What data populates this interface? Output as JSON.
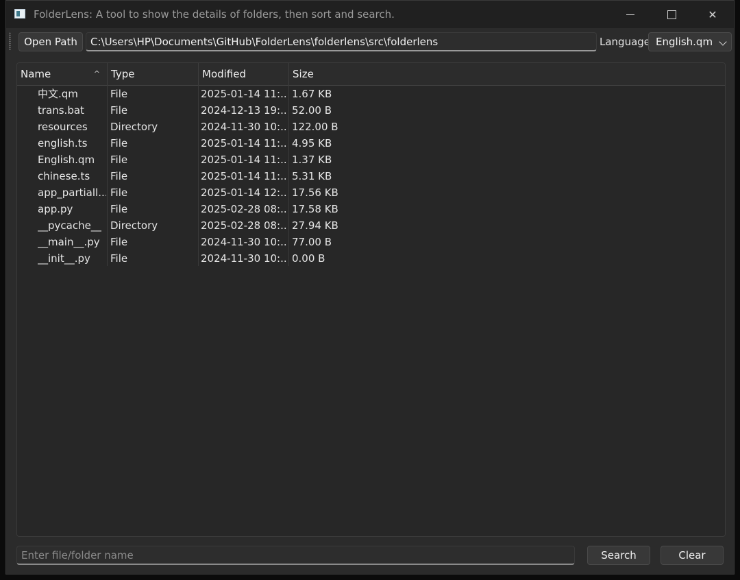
{
  "window": {
    "title": "FolderLens: A tool to show the details of folders, then sort and search."
  },
  "toolbar": {
    "open_path_label": "Open Path",
    "path_value": "C:\\Users\\HP\\Documents\\GitHub\\FolderLens\\folderlens\\src\\folderlens",
    "language_label": "Language",
    "language_selected": "English.qm"
  },
  "table": {
    "columns": [
      "Name",
      "Type",
      "Modified",
      "Size"
    ],
    "sort_indicator": "^",
    "rows": [
      {
        "name": "中文.qm",
        "type": "File",
        "modified": "2025-01-14 11:...",
        "size": "1.67 KB"
      },
      {
        "name": "trans.bat",
        "type": "File",
        "modified": "2024-12-13 19:...",
        "size": "52.00 B"
      },
      {
        "name": "resources",
        "type": "Directory",
        "modified": "2024-11-30 10:...",
        "size": "122.00 B"
      },
      {
        "name": "english.ts",
        "type": "File",
        "modified": "2025-01-14 11:...",
        "size": "4.95 KB"
      },
      {
        "name": "English.qm",
        "type": "File",
        "modified": "2025-01-14 11:...",
        "size": "1.37 KB"
      },
      {
        "name": "chinese.ts",
        "type": "File",
        "modified": "2025-01-14 11:...",
        "size": "5.31 KB"
      },
      {
        "name": "app_partiall...",
        "type": "File",
        "modified": "2025-01-14 12:...",
        "size": "17.56 KB"
      },
      {
        "name": "app.py",
        "type": "File",
        "modified": "2025-02-28 08:...",
        "size": "17.58 KB"
      },
      {
        "name": "__pycache__",
        "type": "Directory",
        "modified": "2025-02-28 08:...",
        "size": "27.94 KB"
      },
      {
        "name": "__main__.py",
        "type": "File",
        "modified": "2024-11-30 10:...",
        "size": "77.00 B"
      },
      {
        "name": "__init__.py",
        "type": "File",
        "modified": "2024-11-30 10:...",
        "size": "0.00 B"
      }
    ]
  },
  "search": {
    "placeholder": "Enter file/folder name",
    "search_label": "Search",
    "clear_label": "Clear"
  }
}
